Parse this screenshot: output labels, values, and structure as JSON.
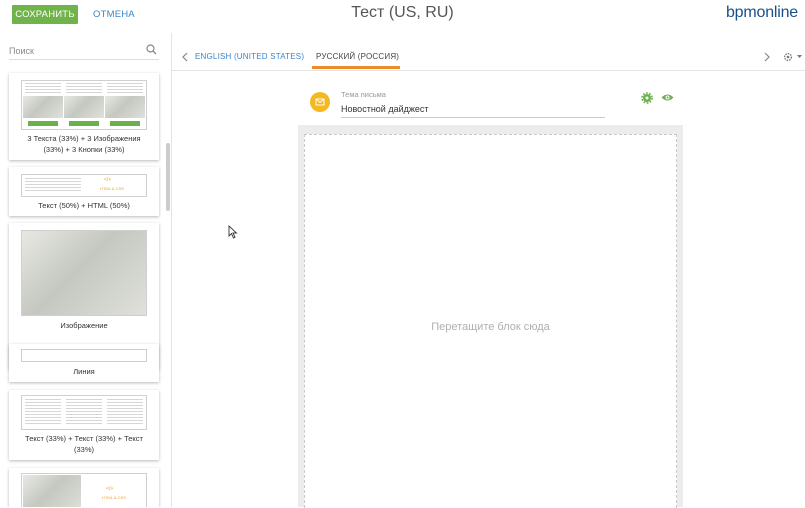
{
  "header": {
    "save_label": "СОХРАНИТЬ",
    "cancel_label": "ОТМЕНА",
    "title": "Тест (US, RU)",
    "logo": "bpmonline"
  },
  "sidebar": {
    "search_placeholder": "Поиск",
    "blocks": [
      {
        "label": "3 Текста (33%) + 3 Изображения (33%) + 3 Кнопки (33%)"
      },
      {
        "label": "Текст (50%) + HTML (50%)",
        "html_label": "HTML & CSS"
      },
      {
        "label": "Изображение"
      },
      {
        "label": "Линия"
      },
      {
        "label": "Текст (33%) + Текст (33%) + Текст (33%)"
      },
      {
        "label": "",
        "html_label": "HTML & CSS"
      }
    ]
  },
  "tabs": [
    {
      "label": "ENGLISH (UNITED STATES)",
      "active": false
    },
    {
      "label": "РУССКИЙ (РОССИЯ)",
      "active": true
    }
  ],
  "email": {
    "subject_label": "Тема письма",
    "subject_value": "Новостной дайджест",
    "drop_placeholder": "Перетащите блок сюда"
  },
  "colors": {
    "save": "#71b34b",
    "accent": "#ed8b2f",
    "link": "#3a86c8",
    "avatar": "#f5b820",
    "icon_green": "#6ab04c"
  }
}
